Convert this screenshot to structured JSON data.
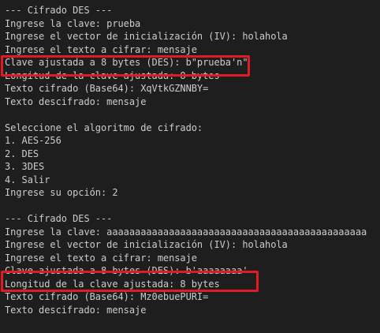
{
  "terminal": {
    "lines": [
      "--- Cifrado DES ---",
      "Ingrese la clave: prueba",
      "Ingrese el vector de inicialización (IV): holahola",
      "Ingrese el texto a cifrar: mensaje",
      "Clave ajustada a 8 bytes (DES): b\"prueba'n\"",
      "Longitud de la clave ajustada: 8 bytes",
      "Texto cifrado (Base64): XqVtkGZNNBY=",
      "Texto descifrado: mensaje",
      "",
      "Seleccione el algoritmo de cifrado:",
      "1. AES-256",
      "2. DES",
      "3. 3DES",
      "4. Salir",
      "Ingrese su opción: 2",
      "",
      "--- Cifrado DES ---",
      "Ingrese la clave: aaaaaaaaaaaaaaaaaaaaaaaaaaaaaaaaaaaaaaaaaaaaaa",
      "Ingrese el vector de inicialización (IV): holahola",
      "Ingrese el texto a cifrar: mensaje",
      "Clave ajustada a 8 bytes (DES): b'aaaaaaaa'",
      "Longitud de la clave ajustada: 8 bytes",
      "Texto cifrado (Base64): Mz0ebuePURI=",
      "Texto descifrado: mensaje"
    ]
  },
  "colors": {
    "background": "#1e1e1e",
    "text": "#cccccc",
    "highlight": "#e01b24"
  }
}
